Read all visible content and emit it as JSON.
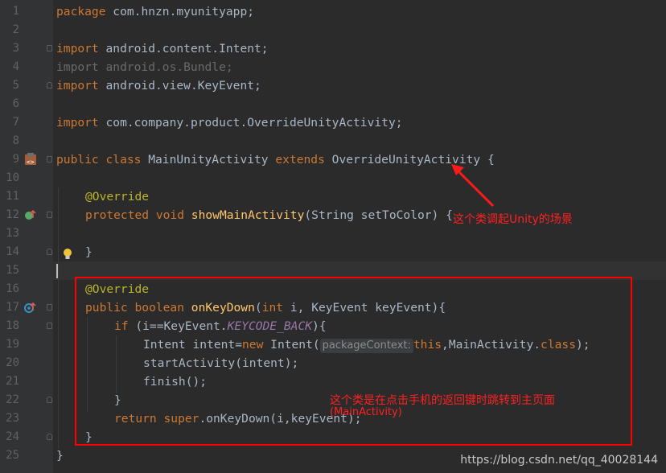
{
  "line_numbers": [
    "1",
    "2",
    "3",
    "4",
    "5",
    "6",
    "7",
    "8",
    "9",
    "10",
    "11",
    "12",
    "13",
    "14",
    "15",
    "16",
    "17",
    "18",
    "19",
    "20",
    "21",
    "22",
    "23",
    "24",
    "25"
  ],
  "code": {
    "l1": {
      "kw": "package",
      "rest": " com.hnzn.myunityapp;"
    },
    "l3": {
      "kw": "import",
      "rest": " android.content.Intent;"
    },
    "l4": {
      "text": "import android.os.Bundle;"
    },
    "l5": {
      "kw": "import",
      "rest": " android.view.KeyEvent;"
    },
    "l7": {
      "kw": "import",
      "rest": " com.company.product.OverrideUnityActivity;"
    },
    "l9": {
      "kw1": "public class",
      "name": " MainUnityActivity ",
      "kw2": "extends",
      "rest": " OverrideUnityActivity {"
    },
    "l11": {
      "ann": "@Override"
    },
    "l12": {
      "kw": "protected void",
      "fn": " showMainActivity",
      "rest": "(String setToColor) {"
    },
    "l14": {
      "text": "}"
    },
    "l16": {
      "ann": "@Override"
    },
    "l17": {
      "kw1": "public boolean",
      "fn": " onKeyDown",
      "p1": "(",
      "kw2": "int",
      "rest": " i, KeyEvent keyEvent){"
    },
    "l18": {
      "kw": "if",
      "p1": " (i==KeyEvent.",
      "const": "KEYCODE_BACK",
      "p2": "){"
    },
    "l19": {
      "p1": "Intent intent=",
      "kw": "new",
      "p2": " Intent(",
      "hint": "packageContext:",
      "kw2": "this",
      "p3": ",MainActivity.",
      "kw3": "class",
      "p4": ");"
    },
    "l20": {
      "text": "startActivity(intent);"
    },
    "l21": {
      "text": "finish();"
    },
    "l22": {
      "text": "}"
    },
    "l23": {
      "kw1": "return",
      "kw2": " super",
      "rest": ".onKeyDown(i,keyEvent);"
    },
    "l24": {
      "text": "}"
    },
    "l25": {
      "text": "}"
    }
  },
  "annotations": {
    "note1": "这个类调起Unity的场景",
    "note2_line1": "这个类是在点击手机的返回键时跳转到主页面",
    "note2_line2": "(MainActivity)"
  },
  "watermark": "https://blog.csdn.net/qq_40028144",
  "icons": [
    "override-icon",
    "implements-icon",
    "bulb-icon",
    "fold-marker"
  ],
  "colors": {
    "annotation_red": "#ff0000",
    "keyword": "#cc7832",
    "function": "#ffc66d",
    "annotation_tag": "#bbb529"
  }
}
